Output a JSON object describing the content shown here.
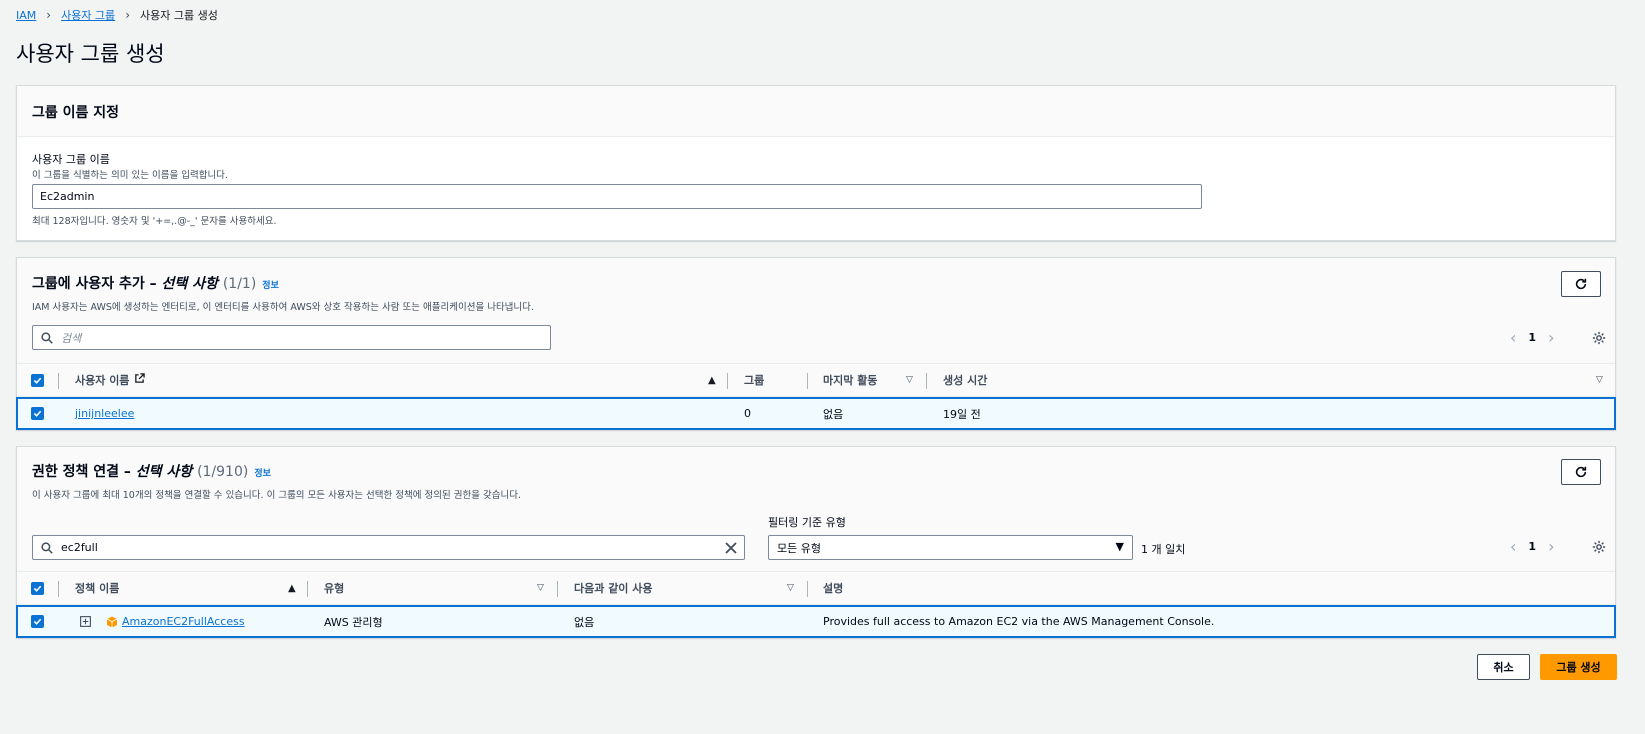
{
  "breadcrumb": {
    "root": "IAM",
    "parent": "사용자 그룹",
    "current": "사용자 그룹 생성"
  },
  "page_title": "사용자 그룹 생성",
  "name_section": {
    "title": "그룹 이름 지정",
    "field_label": "사용자 그룹 이름",
    "field_description": "이 그룹을 식별하는 의미 있는 이름을 입력합니다.",
    "field_value": "Ec2admin",
    "constraint": "최대 128자입니다. 영숫자 및 '+=,.@-_' 문자를 사용하세요."
  },
  "users_section": {
    "title": "그룹에 사용자 추가 – ",
    "title_optional": "선택 사항",
    "count": "(1/1)",
    "info": "정보",
    "description": "IAM 사용자는 AWS에 생성하는 엔터티로, 이 엔터티를 사용하여 AWS와 상호 작용하는 사람 또는 애플리케이션을 나타냅니다.",
    "search_placeholder": "검색",
    "page": "1",
    "columns": {
      "name": "사용자 이름",
      "groups": "그룹",
      "last_activity": "마지막 활동",
      "created": "생성 시간"
    },
    "rows": [
      {
        "name": "jinijnleelee",
        "groups": "0",
        "last_activity": "없음",
        "created": "19일 전"
      }
    ]
  },
  "policies_section": {
    "title": "권한 정책 연결 – ",
    "title_optional": "선택 사항",
    "count": "(1/910)",
    "info": "정보",
    "description": "이 사용자 그룹에 최대 10개의 정책을 연결할 수 있습니다. 이 그룹의 모든 사용자는 선택한 정책에 정의된 권한을 갖습니다.",
    "search_value": "ec2full",
    "filter_label": "필터링 기준 유형",
    "filter_value": "모든 유형",
    "match_count": "1 개 일치",
    "page": "1",
    "columns": {
      "name": "정책 이름",
      "type": "유형",
      "used_as": "다음과 같이 사용",
      "description": "설명"
    },
    "rows": [
      {
        "name": "AmazonEC2FullAccess",
        "type": "AWS 관리형",
        "used_as": "없음",
        "description": "Provides full access to Amazon EC2 via the AWS Management Console."
      }
    ]
  },
  "actions": {
    "cancel": "취소",
    "create": "그룹 생성"
  },
  "colors": {
    "primary": "#ff9900",
    "link": "#0972d3",
    "selected_row": "#f1faff"
  },
  "icons": [
    "chevron-right-icon",
    "external-link-icon",
    "search-icon",
    "clear-icon",
    "refresh-icon",
    "gear-icon",
    "chevron-left-icon",
    "caret-down-icon",
    "sort-asc-icon",
    "sort-desc-icon",
    "expand-icon",
    "aws-managed-policy-icon",
    "checkbox-checked-icon"
  ]
}
